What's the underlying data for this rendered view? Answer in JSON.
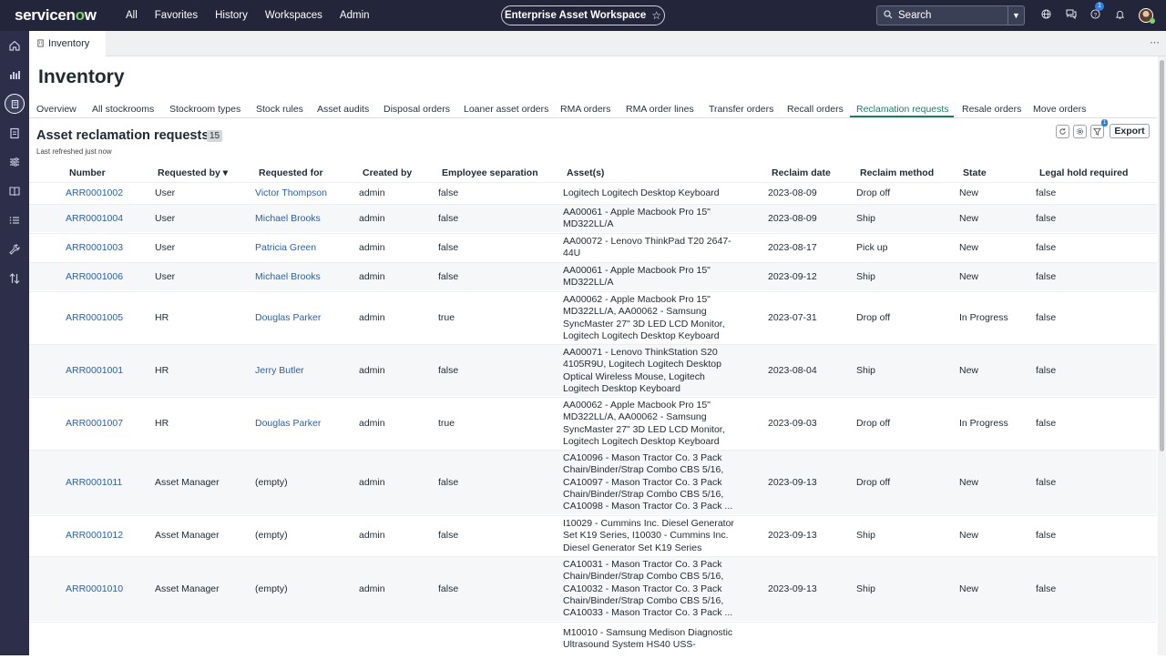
{
  "topbar": {
    "logo_prefix": "servicen",
    "logo_o": "o",
    "logo_suffix": "w",
    "nav": [
      "All",
      "Favorites",
      "History",
      "Workspaces",
      "Admin"
    ],
    "workspace_title": "Enterprise Asset Workspace",
    "search_placeholder": "Search",
    "help_badge": "1"
  },
  "tab": {
    "label": "Inventory"
  },
  "page_title": "Inventory",
  "subtabs": [
    "Overview",
    "All stockrooms",
    "Stockroom types",
    "Stock rules",
    "Asset audits",
    "Disposal orders",
    "Loaner asset orders",
    "RMA orders",
    "RMA order lines",
    "Transfer orders",
    "Recall orders",
    "Reclamation requests",
    "Resale orders",
    "Move orders"
  ],
  "active_subtab": "Reclamation requests",
  "list": {
    "title": "Asset reclamation requests",
    "count": "15",
    "refreshed": "Last refreshed just now",
    "filter_badge": "1",
    "export_label": "Export"
  },
  "columns": [
    "Number",
    "Requested by",
    "Requested for",
    "Created by",
    "Employee separation",
    "Asset(s)",
    "Reclaim date",
    "Reclaim method",
    "State",
    "Legal hold required"
  ],
  "sort_indicator": "▾",
  "rows": [
    {
      "number": "ARR0001002",
      "requested_by": "User",
      "requested_for": "Victor Thompson",
      "created_by": "admin",
      "employee_separation": "false",
      "assets": "Logitech Logitech Desktop Keyboard",
      "reclaim_date": "2023-08-09",
      "reclaim_method": "Drop off",
      "state": "New",
      "legal_hold": "false"
    },
    {
      "number": "ARR0001004",
      "requested_by": "User",
      "requested_for": "Michael Brooks",
      "created_by": "admin",
      "employee_separation": "false",
      "assets": "AA00061 - Apple Macbook Pro 15\" MD322LL/A",
      "reclaim_date": "2023-08-09",
      "reclaim_method": "Ship",
      "state": "New",
      "legal_hold": "false"
    },
    {
      "number": "ARR0001003",
      "requested_by": "User",
      "requested_for": "Patricia Green",
      "created_by": "admin",
      "employee_separation": "false",
      "assets": "AA00072 - Lenovo ThinkPad T20 2647-44U",
      "reclaim_date": "2023-08-17",
      "reclaim_method": "Pick up",
      "state": "New",
      "legal_hold": "false"
    },
    {
      "number": "ARR0001006",
      "requested_by": "User",
      "requested_for": "Michael Brooks",
      "created_by": "admin",
      "employee_separation": "false",
      "assets": "AA00061 - Apple Macbook Pro 15\" MD322LL/A",
      "reclaim_date": "2023-09-12",
      "reclaim_method": "Ship",
      "state": "New",
      "legal_hold": "false"
    },
    {
      "number": "ARR0001005",
      "requested_by": "HR",
      "requested_for": "Douglas Parker",
      "created_by": "admin",
      "employee_separation": "true",
      "assets": "AA00062 - Apple Macbook Pro 15\" MD322LL/A, AA00062 - Samsung SyncMaster 27\" 3D LED LCD Monitor, Logitech Logitech Desktop Keyboard",
      "reclaim_date": "2023-07-31",
      "reclaim_method": "Drop off",
      "state": "In Progress",
      "legal_hold": "false"
    },
    {
      "number": "ARR0001001",
      "requested_by": "HR",
      "requested_for": "Jerry Butler",
      "created_by": "admin",
      "employee_separation": "false",
      "assets": "AA00071 - Lenovo ThinkStation S20 4105R9U, Logitech Logitech Desktop Optical Wireless Mouse, Logitech Logitech Desktop Keyboard",
      "reclaim_date": "2023-08-04",
      "reclaim_method": "Ship",
      "state": "New",
      "legal_hold": "false"
    },
    {
      "number": "ARR0001007",
      "requested_by": "HR",
      "requested_for": "Douglas Parker",
      "created_by": "admin",
      "employee_separation": "true",
      "assets": "AA00062 - Apple Macbook Pro 15\" MD322LL/A, AA00062 - Samsung SyncMaster 27\" 3D LED LCD Monitor, Logitech Logitech Desktop Keyboard",
      "reclaim_date": "2023-09-03",
      "reclaim_method": "Drop off",
      "state": "In Progress",
      "legal_hold": "false"
    },
    {
      "number": "ARR0001011",
      "requested_by": "Asset Manager",
      "requested_for": "(empty)",
      "created_by": "admin",
      "employee_separation": "false",
      "assets": "CA10096 - Mason Tractor Co. 3 Pack Chain/Binder/Strap Combo CBS 5/16, CA10097 - Mason Tractor Co. 3 Pack Chain/Binder/Strap Combo CBS 5/16, CA10098 - Mason Tractor Co. 3 Pack ...",
      "reclaim_date": "2023-09-13",
      "reclaim_method": "Drop off",
      "state": "New",
      "legal_hold": "false"
    },
    {
      "number": "ARR0001012",
      "requested_by": "Asset Manager",
      "requested_for": "(empty)",
      "created_by": "admin",
      "employee_separation": "false",
      "assets": "I10029 - Cummins Inc. Diesel Generator Set K19 Series, I10030 - Cummins Inc. Diesel Generator Set K19 Series",
      "reclaim_date": "2023-09-13",
      "reclaim_method": "Ship",
      "state": "New",
      "legal_hold": "false"
    },
    {
      "number": "ARR0001010",
      "requested_by": "Asset Manager",
      "requested_for": "(empty)",
      "created_by": "admin",
      "employee_separation": "false",
      "assets": "CA10031 - Mason Tractor Co. 3 Pack Chain/Binder/Strap Combo CBS 5/16, CA10032 - Mason Tractor Co. 3 Pack Chain/Binder/Strap Combo CBS 5/16, CA10033 - Mason Tractor Co. 3 Pack ...",
      "reclaim_date": "2023-09-13",
      "reclaim_method": "Ship",
      "state": "New",
      "legal_hold": "false"
    },
    {
      "number": "",
      "requested_by": "",
      "requested_for": "",
      "created_by": "",
      "employee_separation": "",
      "assets": "M10010 - Samsung Medison Diagnostic Ultrasound System HS40 USS-",
      "reclaim_date": "",
      "reclaim_method": "",
      "state": "",
      "legal_hold": ""
    }
  ],
  "colors": {
    "topbar": "#23263a",
    "rail": "#2c2f47",
    "link": "#2e5fa8",
    "active_tab": "#1f7a6a",
    "accent_green": "#7fd46b"
  }
}
